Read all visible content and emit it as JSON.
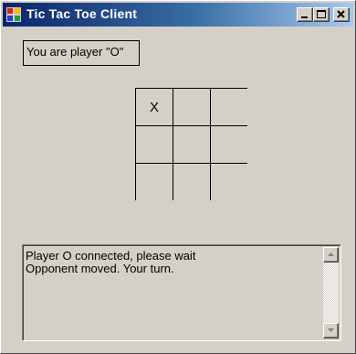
{
  "window": {
    "title": "Tic Tac Toe Client",
    "title_bar_colors": [
      "#0a246a",
      "#a6caf0"
    ],
    "controls": [
      "minimize-icon",
      "maximize-icon",
      "close-icon"
    ]
  },
  "player_label": "You are player \"O\"",
  "board": {
    "cells": [
      "X",
      "",
      "",
      "",
      "",
      "",
      "",
      "",
      ""
    ]
  },
  "log": {
    "lines": [
      "Player O connected, please wait",
      "Opponent moved.  Your turn."
    ],
    "scroll_icons": [
      "scroll-up-arrow-icon",
      "scroll-down-arrow-icon"
    ]
  }
}
